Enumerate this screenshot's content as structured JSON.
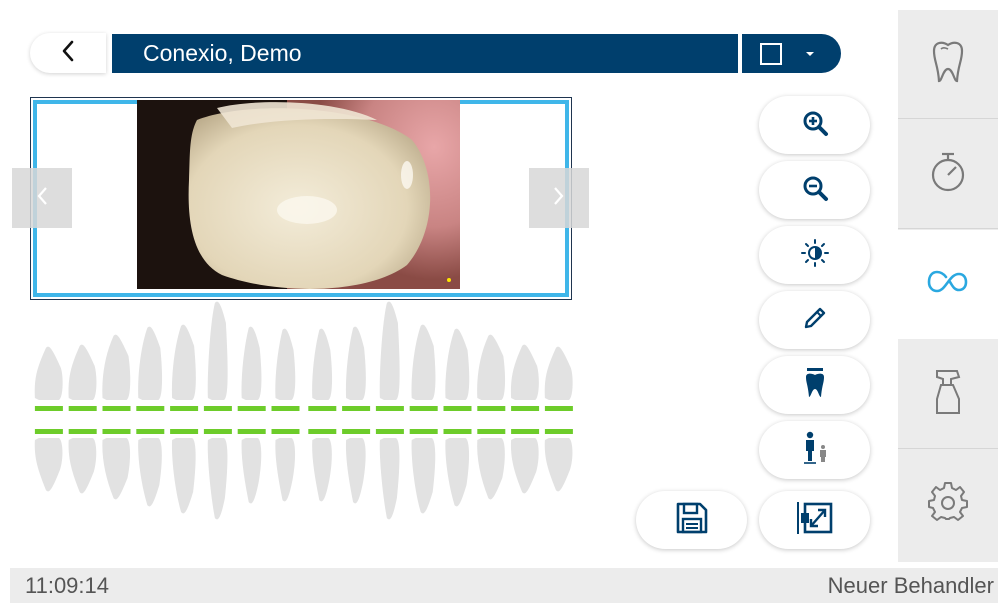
{
  "header": {
    "back_icon": "chevron-left-icon",
    "patient_name": "Conexio, Demo",
    "view_mode_icon": "single-view-square-icon"
  },
  "image_viewer": {
    "prev_icon": "chevron-left-icon",
    "next_icon": "chevron-right-icon",
    "frame_color": "#3fb6e9"
  },
  "dental_chart": {
    "upper_teeth": 16,
    "lower_teeth": 16,
    "status_color": "#6dcc2a"
  },
  "tools": [
    {
      "name": "zoom-in",
      "icon": "zoom-in-icon"
    },
    {
      "name": "zoom-out",
      "icon": "zoom-out-icon"
    },
    {
      "name": "brightness",
      "icon": "brightness-contrast-icon"
    },
    {
      "name": "annotate",
      "icon": "pencil-icon"
    },
    {
      "name": "tooth-filter",
      "icon": "tooth-icon"
    },
    {
      "name": "patient-view",
      "icon": "person-icon"
    },
    {
      "name": "fullscreen",
      "icon": "expand-icon"
    },
    {
      "name": "save",
      "icon": "floppy-disk-icon"
    }
  ],
  "sidenav": [
    {
      "name": "treatment",
      "icon": "tooth-outline-icon",
      "active": false
    },
    {
      "name": "timer",
      "icon": "stopwatch-icon",
      "active": false
    },
    {
      "name": "connect",
      "icon": "infinity-link-icon",
      "active": true
    },
    {
      "name": "hygiene",
      "icon": "spray-bottle-icon",
      "active": false
    },
    {
      "name": "settings",
      "icon": "gear-icon",
      "active": false
    }
  ],
  "status": {
    "time": "11:09:14",
    "user": "Neuer Behandler"
  },
  "colors": {
    "primary": "#003f6d",
    "accent": "#2aa8e0",
    "icon": "#003f6d"
  }
}
